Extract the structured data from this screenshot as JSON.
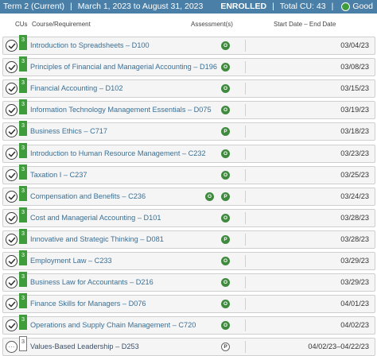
{
  "term": {
    "title": "Term 2 (Current)",
    "separator": "|",
    "date_range": "March 1, 2023 to August 31, 2023",
    "enrolled": "ENROLLED",
    "total_cu": "Total CU: 43",
    "status": "Good",
    "status_color": "#3f9c3a"
  },
  "columns": {
    "cus": "CUs",
    "course": "Course/Requirement",
    "assessment": "Assessment(s)",
    "dates": "Start Date – End Date"
  },
  "courses": [
    {
      "cu": "3",
      "title": "Introduction to Spreadsheets – D100",
      "assessments": [
        "O"
      ],
      "date": "03/04/23",
      "completed": true
    },
    {
      "cu": "3",
      "title": "Principles of Financial and Managerial Accounting – D196",
      "assessments": [
        "O"
      ],
      "date": "03/08/23",
      "completed": true
    },
    {
      "cu": "3",
      "title": "Financial Accounting – D102",
      "assessments": [
        "O"
      ],
      "date": "03/15/23",
      "completed": true
    },
    {
      "cu": "3",
      "title": "Information Technology Management Essentials – D075",
      "assessments": [
        "O"
      ],
      "date": "03/19/23",
      "completed": true
    },
    {
      "cu": "3",
      "title": "Business Ethics – C717",
      "assessments": [
        "P"
      ],
      "date": "03/18/23",
      "completed": true
    },
    {
      "cu": "3",
      "title": "Introduction to Human Resource Management – C232",
      "assessments": [
        "O"
      ],
      "date": "03/23/23",
      "completed": true
    },
    {
      "cu": "3",
      "title": "Taxation I – C237",
      "assessments": [
        "O"
      ],
      "date": "03/25/23",
      "completed": true
    },
    {
      "cu": "3",
      "title": "Compensation and Benefits – C236",
      "assessments": [
        "O",
        "P"
      ],
      "date": "03/24/23",
      "completed": true
    },
    {
      "cu": "3",
      "title": "Cost and Managerial Accounting – D101",
      "assessments": [
        "O"
      ],
      "date": "03/28/23",
      "completed": true
    },
    {
      "cu": "3",
      "title": "Innovative and Strategic Thinking – D081",
      "assessments": [
        "P"
      ],
      "date": "03/28/23",
      "completed": true
    },
    {
      "cu": "3",
      "title": "Employment Law – C233",
      "assessments": [
        "O"
      ],
      "date": "03/29/23",
      "completed": true
    },
    {
      "cu": "3",
      "title": "Business Law for Accountants – D216",
      "assessments": [
        "O"
      ],
      "date": "03/29/23",
      "completed": true
    },
    {
      "cu": "3",
      "title": "Finance Skills for Managers – D076",
      "assessments": [
        "O"
      ],
      "date": "04/01/23",
      "completed": true
    },
    {
      "cu": "3",
      "title": "Operations and Supply Chain Management – C720",
      "assessments": [
        "O"
      ],
      "date": "04/02/23",
      "completed": true
    },
    {
      "cu": "3",
      "title": "Values-Based Leadership – D253",
      "assessments": [
        "P"
      ],
      "date": "04/02/23–04/22/23",
      "completed": false
    }
  ]
}
